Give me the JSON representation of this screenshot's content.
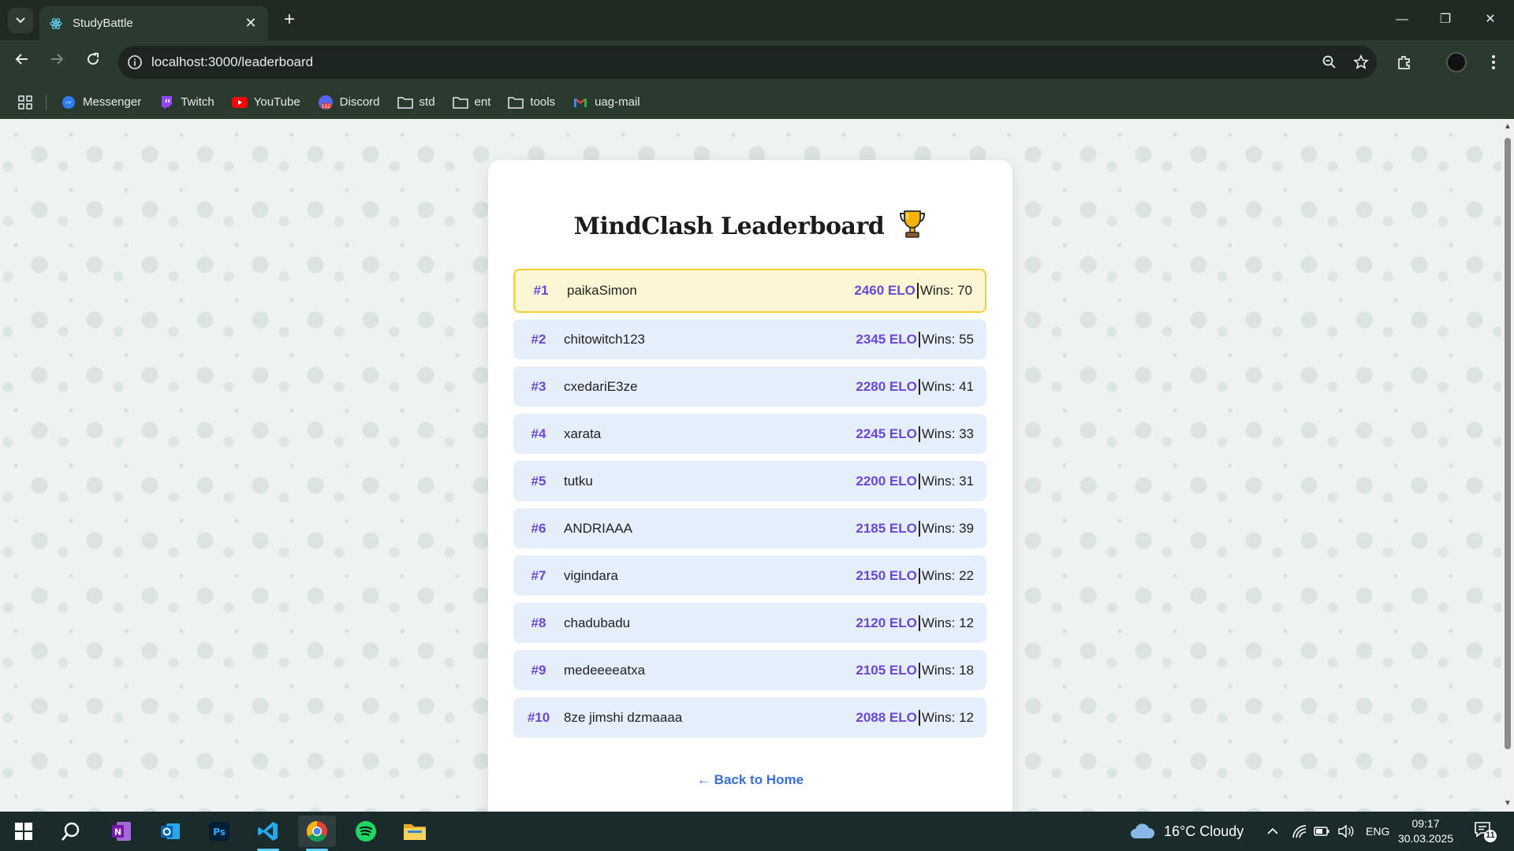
{
  "browser": {
    "tab_title": "StudyBattle",
    "url": "localhost:3000/leaderboard",
    "bookmarks": [
      {
        "label": "Messenger",
        "icon": "messenger-icon"
      },
      {
        "label": "Twitch",
        "icon": "twitch-icon"
      },
      {
        "label": "YouTube",
        "icon": "youtube-icon"
      },
      {
        "label": "Discord",
        "icon": "discord-icon"
      },
      {
        "label": "std",
        "icon": "folder-icon"
      },
      {
        "label": "ent",
        "icon": "folder-icon"
      },
      {
        "label": "tools",
        "icon": "folder-icon"
      },
      {
        "label": "uag-mail",
        "icon": "gmail-icon"
      }
    ]
  },
  "leaderboard": {
    "title": "MindClash Leaderboard",
    "rows": [
      {
        "rank": "#1",
        "name": "paikaSimon",
        "elo": "2460 ELO",
        "wins": "Wins: 70"
      },
      {
        "rank": "#2",
        "name": "chitowitch123",
        "elo": "2345 ELO",
        "wins": "Wins: 55"
      },
      {
        "rank": "#3",
        "name": "cxedariE3ze",
        "elo": "2280 ELO",
        "wins": "Wins: 41"
      },
      {
        "rank": "#4",
        "name": "xarata",
        "elo": "2245 ELO",
        "wins": "Wins: 33"
      },
      {
        "rank": "#5",
        "name": "tutku",
        "elo": "2200 ELO",
        "wins": "Wins: 31"
      },
      {
        "rank": "#6",
        "name": "ANDRIAAA",
        "elo": "2185 ELO",
        "wins": "Wins: 39"
      },
      {
        "rank": "#7",
        "name": "vigindara",
        "elo": "2150 ELO",
        "wins": "Wins: 22"
      },
      {
        "rank": "#8",
        "name": "chadubadu",
        "elo": "2120 ELO",
        "wins": "Wins: 12"
      },
      {
        "rank": "#9",
        "name": "medeeeeatxa",
        "elo": "2105 ELO",
        "wins": "Wins: 18"
      },
      {
        "rank": "#10",
        "name": "8ze jimshi dzmaaaa",
        "elo": "2088 ELO",
        "wins": "Wins: 12"
      }
    ],
    "back_link": "← Back to Home"
  },
  "taskbar": {
    "weather": "16°C  Cloudy",
    "language": "ENG",
    "time": "09:17",
    "date": "30.03.2025",
    "notification_count": "11"
  },
  "colors": {
    "accent": "#6a48d7",
    "highlight_bg": "#fdf6d5",
    "highlight_border": "#f4cf34",
    "row_bg": "#e5eefb",
    "link": "#3a6fd8"
  }
}
